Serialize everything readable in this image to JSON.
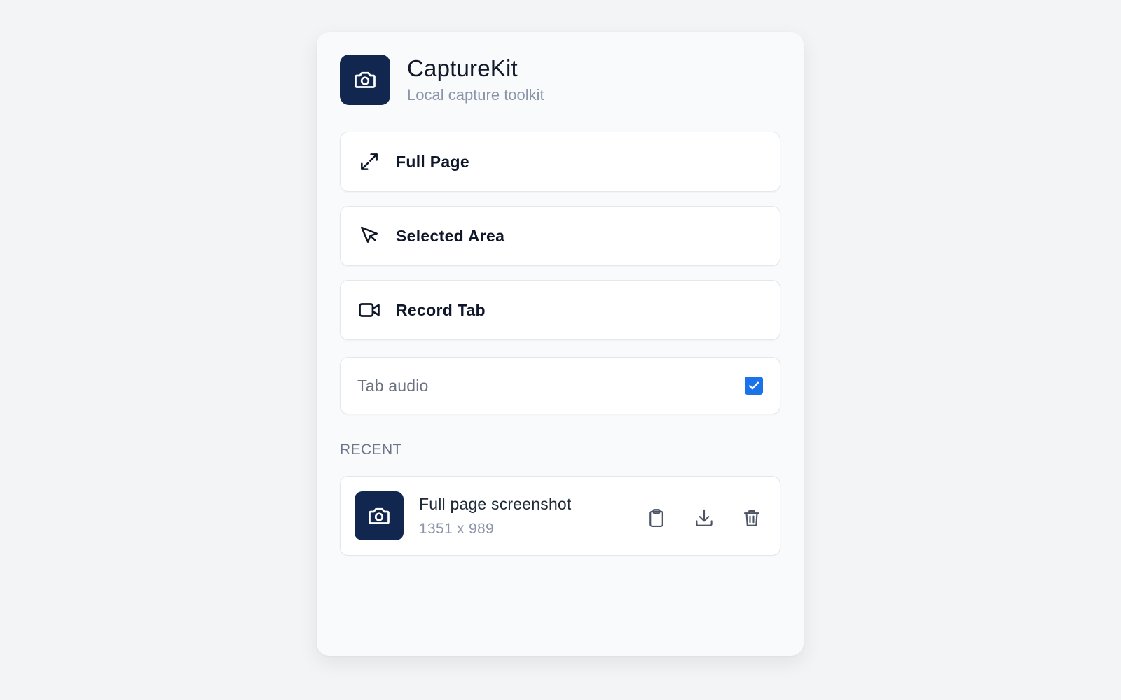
{
  "app": {
    "title": "CaptureKit",
    "subtitle": "Local capture toolkit",
    "logo_icon": "camera-icon"
  },
  "actions": [
    {
      "label": "Full Page",
      "icon": "expand-arrows-icon"
    },
    {
      "label": "Selected Area",
      "icon": "cursor-pointer-icon"
    },
    {
      "label": "Record Tab",
      "icon": "video-camera-icon"
    }
  ],
  "options": {
    "tab_audio": {
      "label": "Tab audio",
      "checked": true
    }
  },
  "recent": {
    "section_title": "RECENT",
    "items": [
      {
        "name": "Full page screenshot",
        "meta": "1351 x 989",
        "icon": "camera-icon",
        "action_icons": [
          "clipboard-icon",
          "download-icon",
          "trash-icon"
        ]
      }
    ]
  },
  "colors": {
    "brand_dark": "#12274f",
    "accent_blue": "#1a73e8",
    "muted_text": "#8b95a9",
    "background": "#f3f4f6"
  }
}
